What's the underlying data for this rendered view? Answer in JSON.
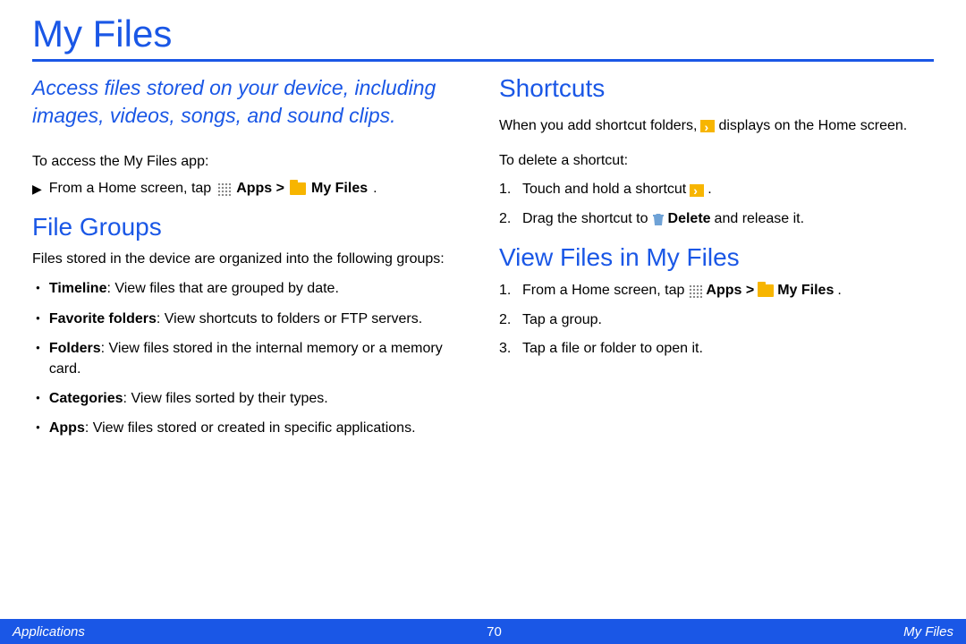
{
  "title": "My Files",
  "lead": "Access files stored on your device, including images, videos, songs, and sound clips.",
  "access_intro": "To access the My Files app:",
  "access_line": {
    "prefix": "From a Home screen, tap",
    "apps_label": "Apps >",
    "myfiles_label": "My Files",
    "period": "."
  },
  "file_groups": {
    "heading": "File Groups",
    "intro": "Files stored in the device are organized into the following groups:",
    "items": [
      {
        "term": "Timeline",
        "desc": ": View files that are grouped by date."
      },
      {
        "term": "Favorite folders",
        "desc": ": View shortcuts to folders or FTP servers."
      },
      {
        "term": "Folders",
        "desc": ": View files stored in the internal memory or a memory card."
      },
      {
        "term": "Categories",
        "desc": ": View files sorted by their types."
      },
      {
        "term": "Apps",
        "desc": ": View files stored or created in specific applications."
      }
    ]
  },
  "shortcuts": {
    "heading": "Shortcuts",
    "line1_a": "When you add shortcut folders,",
    "line1_b": "displays on the Home screen.",
    "delete_intro": "To delete a shortcut:",
    "steps": {
      "s1": "Touch and hold a shortcut",
      "s1_end": ".",
      "s2_a": "Drag the shortcut to",
      "s2_b": "Delete",
      "s2_c": "and release it."
    }
  },
  "view_files": {
    "heading": "View Files in My Files",
    "s1_prefix": "From a Home screen, tap",
    "s1_apps": "Apps >",
    "s1_myfiles": "My Files",
    "s1_end": ".",
    "s2": "Tap a group.",
    "s3": "Tap a file or folder to open it."
  },
  "footer": {
    "left": "Applications",
    "page": "70",
    "right": "My Files"
  }
}
